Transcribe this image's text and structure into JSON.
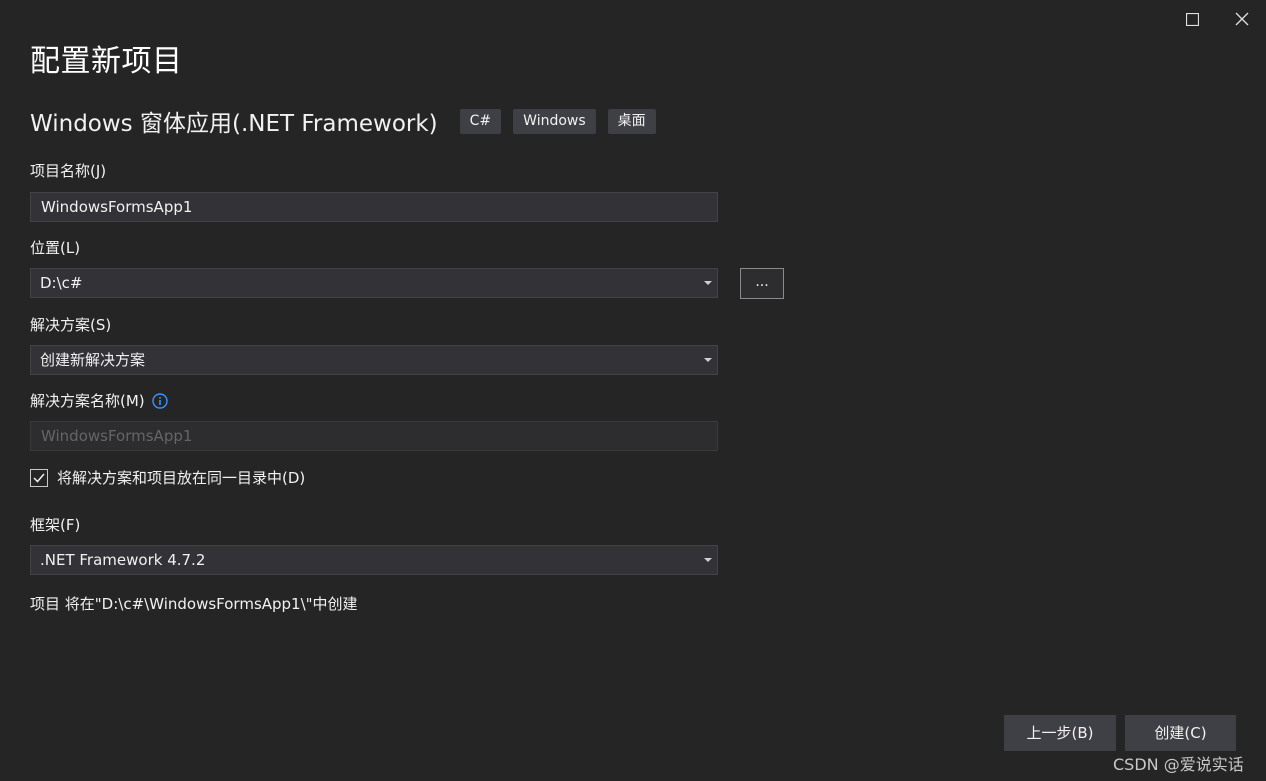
{
  "window": {
    "title": "配置新项目",
    "maximize_icon": "maximize-icon",
    "close_icon": "close-icon"
  },
  "template": {
    "name": "Windows 窗体应用(.NET Framework)",
    "tags": [
      "C#",
      "Windows",
      "桌面"
    ]
  },
  "project_name": {
    "label": "项目名称(J)",
    "value": "WindowsFormsApp1"
  },
  "location": {
    "label": "位置(L)",
    "value": "D:\\c#",
    "browse_label": "..."
  },
  "solution": {
    "label": "解决方案(S)",
    "value": "创建新解决方案"
  },
  "solution_name": {
    "label": "解决方案名称(M)",
    "value": "WindowsFormsApp1",
    "info_icon": "info-icon",
    "disabled": true
  },
  "same_dir": {
    "label": "将解决方案和项目放在同一目录中(D)",
    "checked": true
  },
  "framework": {
    "label": "框架(F)",
    "value": ".NET Framework 4.7.2"
  },
  "create_path": "项目 将在\"D:\\c#\\WindowsFormsApp1\\\"中创建",
  "buttons": {
    "back": "上一步(B)",
    "create": "创建(C)"
  },
  "watermark": "CSDN @爱说实话",
  "colors": {
    "background": "#252526",
    "field": "#333337",
    "button": "#3f3f46",
    "info_blue": "#3794ff"
  }
}
